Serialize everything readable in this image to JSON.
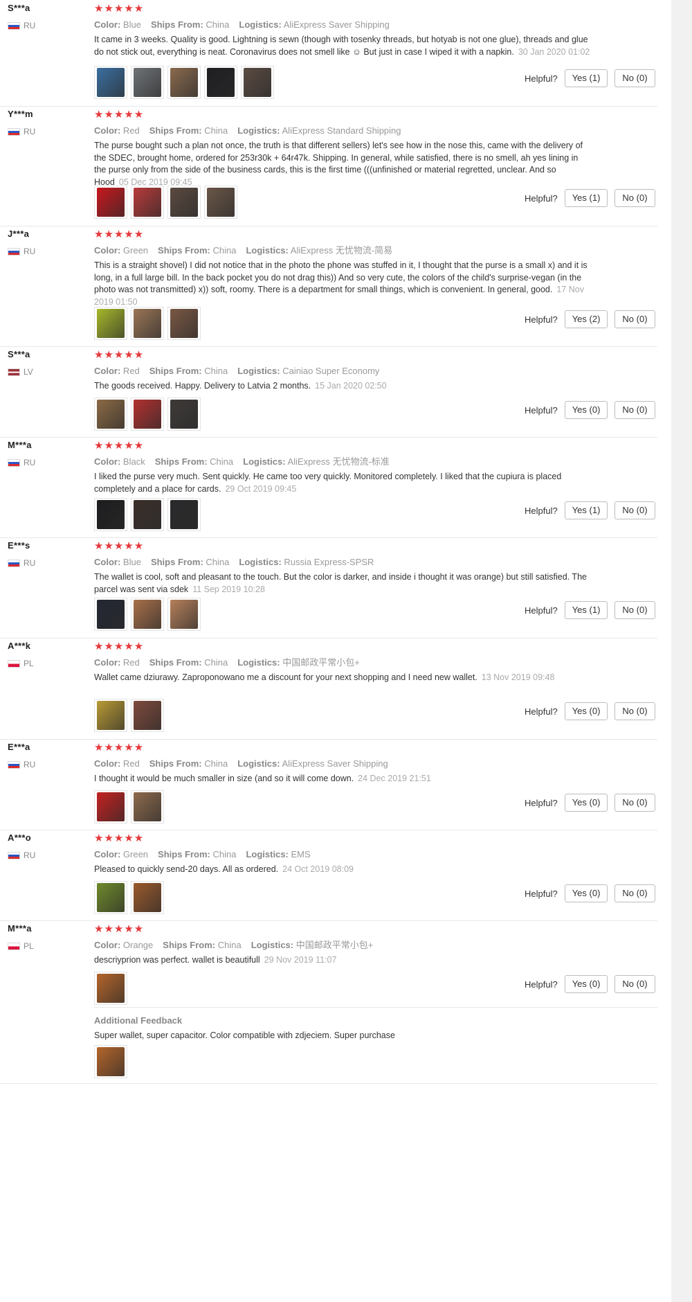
{
  "labels": {
    "color": "Color:",
    "ships_from": "Ships From:",
    "logistics": "Logistics:",
    "helpful": "Helpful?",
    "additional_feedback": "Additional Feedback"
  },
  "rating_stars": "★★★★★",
  "colors": {
    "star": "#e4393c",
    "meta_label": "#888888",
    "date": "#aaaaaa",
    "divider": "#e8e8e8"
  },
  "reviews": [
    {
      "user": "S***a",
      "country": "RU",
      "color": "Blue",
      "ships_from": "China",
      "logistics": "AliExpress Saver Shipping",
      "text": "It came in 3 weeks. Quality is good. Lightning is sewn (though with tosenky threads, but hotyab is not one glue), threads and glue do not stick out, everything is neat. Coronavirus does not smell like ☺ But just in case I wiped it with a napkin.",
      "date": "30 Jan 2020 01:02",
      "yes": "Yes (1)",
      "no": "No (0)",
      "photos": [
        {
          "name": "photo-wallet-blue-phone",
          "color": "#3a6fa0"
        },
        {
          "name": "photo-wallet-grey-phone",
          "color": "#6f7377"
        },
        {
          "name": "photo-wallet-brown-inside",
          "color": "#8a6a4e"
        },
        {
          "name": "photo-wallet-black-phone",
          "color": "#1f1f22"
        },
        {
          "name": "photo-wallet-open-dark",
          "color": "#5a4b42"
        }
      ]
    },
    {
      "user": "Y***m",
      "country": "RU",
      "color": "Red",
      "ships_from": "China",
      "logistics": "AliExpress Standard Shipping",
      "text": "The purse bought such a plan not once, the truth is that different sellers) let's see how in the nose this, came with the delivery of the SDEC, brought home, ordered for 253r30k + 64r47k. Shipping. In general, while satisfied, there is no smell, ah yes lining in the purse only from the side of the business cards, this is the first time (((unfinished or material regretted, unclear. And so Hood",
      "date": "05 Dec 2019 09:45",
      "yes": "Yes (1)",
      "no": "No (0)",
      "photos": [
        {
          "name": "photo-wallet-red",
          "color": "#c8181e"
        },
        {
          "name": "photo-wallet-red-open",
          "color": "#b83a3a"
        },
        {
          "name": "photo-wallet-dark-open",
          "color": "#5b4a40"
        },
        {
          "name": "photo-wallet-dark-hand",
          "color": "#6a5648"
        }
      ]
    },
    {
      "user": "J***a",
      "country": "RU",
      "color": "Green",
      "ships_from": "China",
      "logistics": "AliExpress 无忧物流-简易",
      "text": "This is a straight shovel) I did not notice that in the photo the phone was stuffed in it, I thought that the purse is a small x) and it is long, in a full large bill. In the back pocket you do not drag this)) And so very cute, the colors of the child's surprise-vegan (in the photo was not transmitted) x)) soft, roomy. There is a department for small things, which is convenient. In general, good.",
      "date": "17 Nov 2019 01:50",
      "yes": "Yes (2)",
      "no": "No (0)",
      "photos": [
        {
          "name": "photo-wallet-green",
          "color": "#a6b82a"
        },
        {
          "name": "photo-wallet-box",
          "color": "#9a7556"
        },
        {
          "name": "photo-wallet-open-cards",
          "color": "#7a5844"
        }
      ]
    },
    {
      "user": "S***a",
      "country": "LV",
      "color": "Red",
      "ships_from": "China",
      "logistics": "Cainiao Super Economy",
      "text": "The goods received. Happy. Delivery to Latvia 2 months.",
      "date": "15 Jan 2020 02:50",
      "yes": "Yes (0)",
      "no": "No (0)",
      "photos": [
        {
          "name": "photo-wallet-brown-hand",
          "color": "#8b6a45"
        },
        {
          "name": "photo-wallet-red-card",
          "color": "#b23030"
        },
        {
          "name": "photo-wallet-dark-hand-2",
          "color": "#3e3a38"
        }
      ]
    },
    {
      "user": "M***a",
      "country": "RU",
      "color": "Black",
      "ships_from": "China",
      "logistics": "AliExpress 无忧物流-标准",
      "text": "I liked the purse very much. Sent quickly. He came too very quickly. Monitored completely. I liked that the cupiura is placed completely and a place for cards.",
      "date": "29 Oct 2019 09:45",
      "yes": "Yes (1)",
      "no": "No (0)",
      "photos": [
        {
          "name": "photo-wallet-black",
          "color": "#1d1d1f"
        },
        {
          "name": "photo-wallet-black-cards",
          "color": "#3b2f2a"
        },
        {
          "name": "photo-wallet-black-open",
          "color": "#2a2a2c"
        }
      ]
    },
    {
      "user": "E***s",
      "country": "RU",
      "color": "Blue",
      "ships_from": "China",
      "logistics": "Russia Express-SPSR",
      "text": "The wallet is cool, soft and pleasant to the touch. But the color is darker, and inside i thought it was orange) but still satisfied. The parcel was sent via sdek",
      "date": "11 Sep 2019 10:28",
      "yes": "Yes (1)",
      "no": "No (0)",
      "photos": [
        {
          "name": "photo-wallet-navy",
          "color": "#232733"
        },
        {
          "name": "photo-wallet-tan-inside",
          "color": "#a8704a"
        },
        {
          "name": "photo-wallet-open-tan",
          "color": "#b5805a"
        }
      ]
    },
    {
      "user": "A***k",
      "country": "PL",
      "color": "Red",
      "ships_from": "China",
      "logistics": "中国邮政平常小包+",
      "text": "Wallet came dziurawy. Zaproponowano me a discount for your next shopping and I need new wallet.",
      "date": "13 Nov 2019 09:48",
      "yes": "Yes (0)",
      "no": "No (0)",
      "photos": [
        {
          "name": "photo-wallet-yellow-black",
          "color": "#b89a35"
        },
        {
          "name": "photo-wallet-damaged",
          "color": "#7e4a3c"
        }
      ]
    },
    {
      "user": "E***a",
      "country": "RU",
      "color": "Red",
      "ships_from": "China",
      "logistics": "AliExpress Saver Shipping",
      "text": "I thought it would be much smaller in size (and so it will come down.",
      "date": "24 Dec 2019 21:51",
      "yes": "Yes (0)",
      "no": "No (0)",
      "photos": [
        {
          "name": "photo-wallet-red-2",
          "color": "#c42121"
        },
        {
          "name": "photo-wallet-open-cards-2",
          "color": "#8d6a4d"
        }
      ]
    },
    {
      "user": "A***o",
      "country": "RU",
      "color": "Green",
      "ships_from": "China",
      "logistics": "EMS",
      "text": "Pleased to quickly send-20 days. All as ordered.",
      "date": "24 Oct 2019 08:09",
      "yes": "Yes (0)",
      "no": "No (0)",
      "photos": [
        {
          "name": "photo-wallet-green-2",
          "color": "#6f8a2b"
        },
        {
          "name": "photo-wallet-orange-green",
          "color": "#9a5a2c"
        }
      ]
    },
    {
      "user": "M***a",
      "country": "PL",
      "color": "Orange",
      "ships_from": "China",
      "logistics": "中国邮政平常小包+",
      "text": "descriyprion was perfect. wallet is beautifull",
      "date": "29 Nov 2019 11:07",
      "yes": "Yes (0)",
      "no": "No (0)",
      "photos": [
        {
          "name": "photo-wallet-orange",
          "color": "#b4652a"
        }
      ],
      "additional": {
        "text": "Super wallet, super capacitor. Color compatible with zdjeciem. Super purchase",
        "photos": [
          {
            "name": "photo-wallet-orange-2",
            "color": "#b4652a"
          }
        ]
      }
    }
  ]
}
